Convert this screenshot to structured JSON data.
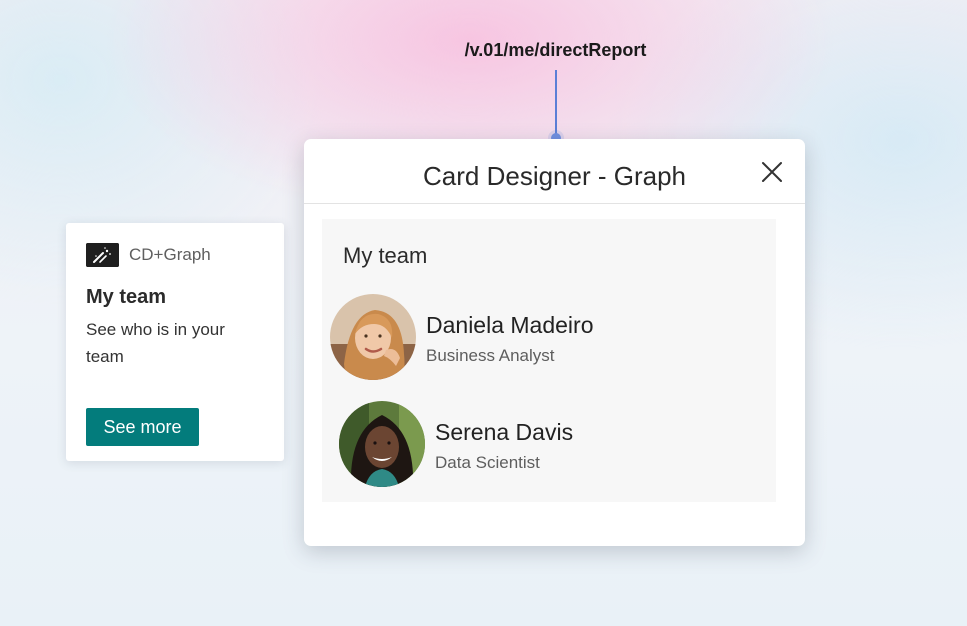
{
  "endpoint": {
    "label": "/v.01/me/directReport",
    "connector_color": "#5b7fd6"
  },
  "teaser": {
    "app_icon": "adaptive-card-graph-icon",
    "app_name": "CD+Graph",
    "title": "My team",
    "description": "See who is in your team",
    "button_label": "See more",
    "accent_color": "#037c7c"
  },
  "dialog": {
    "title": "Card Designer - Graph",
    "close_icon": "close-icon",
    "section_title": "My team",
    "people": [
      {
        "name": "Daniela Madeiro",
        "role": "Business Analyst",
        "avatar": "avatar-photo"
      },
      {
        "name": "Serena Davis",
        "role": "Data Scientist",
        "avatar": "avatar-photo"
      }
    ]
  }
}
